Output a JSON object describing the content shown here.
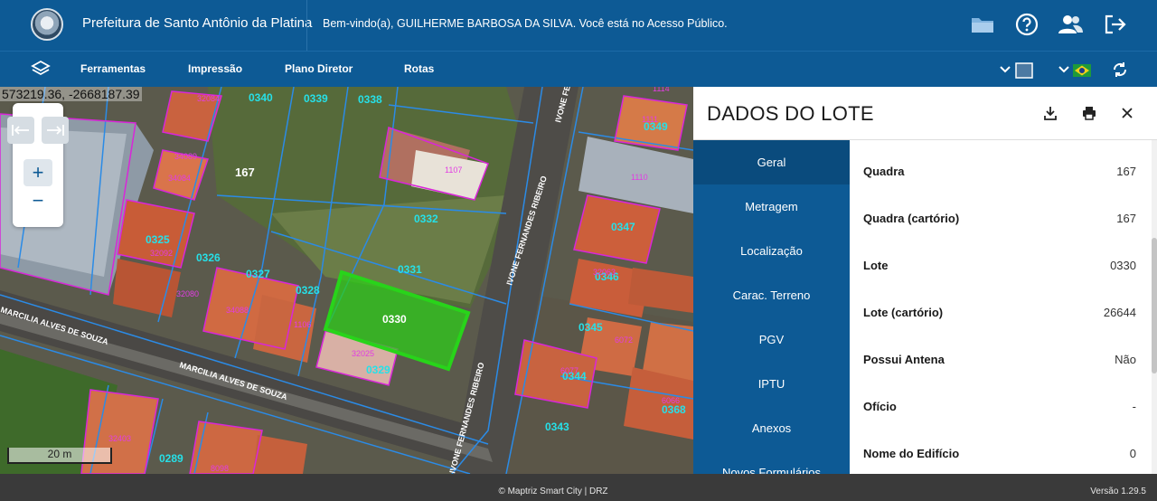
{
  "header": {
    "app_title": "Prefeitura de Santo Antônio da Platina",
    "welcome": "Bem-vindo(a), GUILHERME BARBOSA DA SILVA. Você está no Acesso Público.",
    "icons": [
      "folder-icon",
      "help-icon",
      "users-icon",
      "logout-icon"
    ]
  },
  "nav": {
    "items": [
      "Ferramentas",
      "Impressão",
      "Plano Diretor",
      "Rotas"
    ]
  },
  "map": {
    "coordinates": "573219.36, -2668187.39",
    "scale_label": "20 m",
    "zoom_in": "+",
    "zoom_out": "−",
    "street_labels": [
      "MARCILIA ALVES DE SOUZA",
      "MARCILIA ALVES DE SOUZA",
      "IVONE FERNANDES RIBEIRO",
      "IVONE FERNANDES RIBEIRO",
      "IVONE FERNANDES RIBEIRO"
    ],
    "block_label": "167",
    "lot_labels": [
      {
        "id": "0340"
      },
      {
        "id": "0339"
      },
      {
        "id": "0338"
      },
      {
        "id": "0332"
      },
      {
        "id": "0331"
      },
      {
        "id": "0330"
      },
      {
        "id": "0329"
      },
      {
        "id": "0328"
      },
      {
        "id": "0327"
      },
      {
        "id": "0326"
      },
      {
        "id": "0325"
      },
      {
        "id": "0289"
      },
      {
        "id": "0349"
      },
      {
        "id": "0347"
      },
      {
        "id": "0346"
      },
      {
        "id": "0345"
      },
      {
        "id": "0344"
      },
      {
        "id": "0343"
      },
      {
        "id": "0368"
      }
    ],
    "building_labels": [
      "32084",
      "34089",
      "34084",
      "32092",
      "32080",
      "34088",
      "1106",
      "32025",
      "1107",
      "1111",
      "1110",
      "6072",
      "6077",
      "6066",
      "32063",
      "8098",
      "32403",
      "1114"
    ]
  },
  "panel": {
    "title": "DADOS DO LOTE",
    "tabs": [
      "Geral",
      "Metragem",
      "Localização",
      "Carac. Terreno",
      "PGV",
      "IPTU",
      "Anexos",
      "Novos Formulários"
    ],
    "active_tab": "Geral",
    "fields": [
      {
        "label": "Quadra",
        "value": "167"
      },
      {
        "label": "Quadra (cartório)",
        "value": "167"
      },
      {
        "label": "Lote",
        "value": "0330"
      },
      {
        "label": "Lote (cartório)",
        "value": "26644"
      },
      {
        "label": "Possui Antena",
        "value": "Não"
      },
      {
        "label": "Ofício",
        "value": "-"
      },
      {
        "label": "Nome do Edifício",
        "value": "0"
      }
    ]
  },
  "footer": {
    "credit": "© Maptriz Smart City | DRZ",
    "version": "Versão 1.29.5"
  },
  "colors": {
    "primary": "#0d5a95",
    "selected_lot": "#2ecc1a",
    "lot_outline": "#2b8be6",
    "building_outline": "#d926d9"
  }
}
